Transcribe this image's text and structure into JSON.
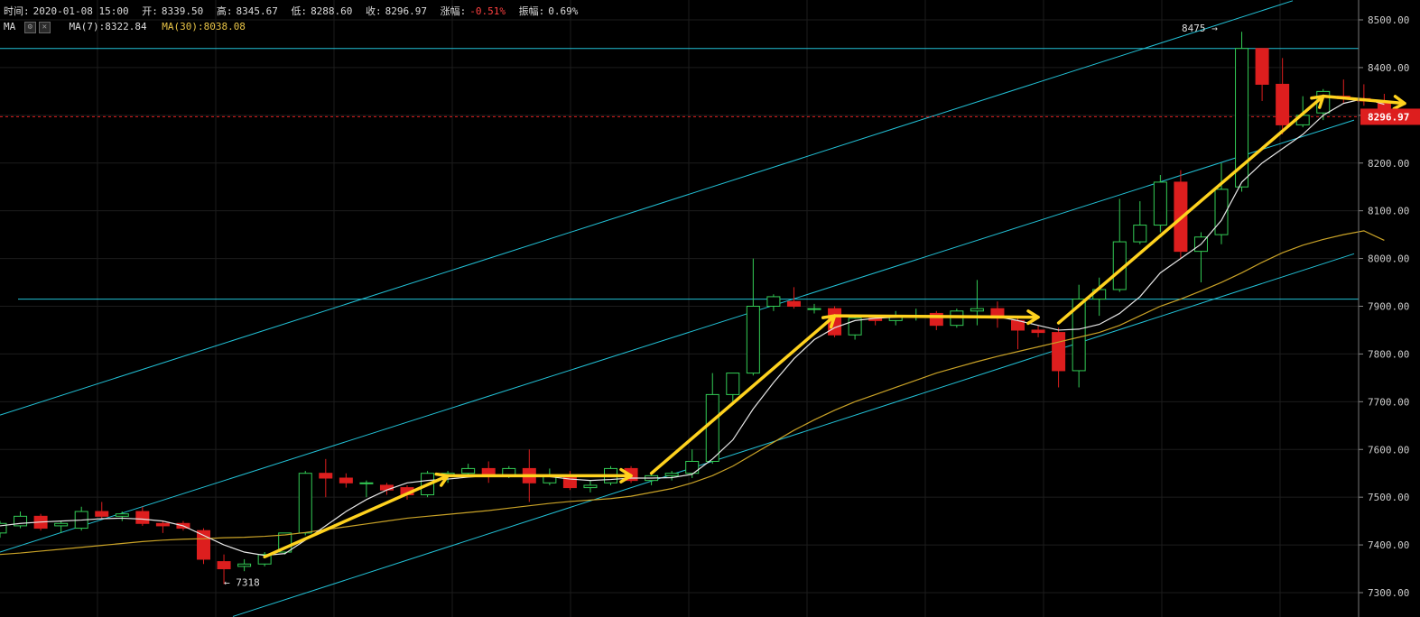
{
  "header": {
    "time_label": "时间:",
    "time_value": "2020-01-08 15:00",
    "open_label": "开:",
    "open_value": "8339.50",
    "high_label": "高:",
    "high_value": "8345.67",
    "low_label": "低:",
    "low_value": "8288.60",
    "close_label": "收:",
    "close_value": "8296.97",
    "change_label": "涨幅:",
    "change_value": "-0.51%",
    "amplitude_label": "振幅:",
    "amplitude_value": "0.69%"
  },
  "indicators": {
    "ma_label": "MA",
    "ma7_text": "MA(7):8322.84",
    "ma30_text": "MA(30):8038.08"
  },
  "colors": {
    "up": "#33cc55",
    "down": "#dd1e1e",
    "ma7": "#e6e6e6",
    "ma30": "#c9a227",
    "trendline": "#22c1d6",
    "arrow": "#ffd21e",
    "current_price": "#dd1e1e",
    "grid": "#1c1c1c"
  },
  "chart_data": {
    "type": "candlestick",
    "yticks": [
      7300,
      7400,
      7500,
      7600,
      7700,
      7800,
      7900,
      8000,
      8100,
      8200,
      8300,
      8400,
      8500
    ],
    "ytick_labels": [
      "7300.00",
      "7400.00",
      "7500.00",
      "7600.00",
      "7700.00",
      "7800.00",
      "7900.00",
      "8000.00",
      "8100.00",
      "8200.00",
      "8300.00",
      "8400.00",
      "8500.00"
    ],
    "ylim": [
      7250,
      8540
    ],
    "current_price": 8296.97,
    "current_price_label": "8296.97",
    "annotations": [
      {
        "text": "← 7318",
        "x": 11,
        "y": 7318
      },
      {
        "text": "8475 →",
        "x": 60,
        "y": 8475
      }
    ],
    "candles": [
      [
        7425,
        7450,
        7415,
        7445
      ],
      [
        7440,
        7470,
        7435,
        7460
      ],
      [
        7460,
        7465,
        7430,
        7435
      ],
      [
        7440,
        7450,
        7425,
        7445
      ],
      [
        7435,
        7480,
        7430,
        7470
      ],
      [
        7470,
        7490,
        7455,
        7460
      ],
      [
        7460,
        7470,
        7450,
        7465
      ],
      [
        7470,
        7480,
        7440,
        7445
      ],
      [
        7445,
        7450,
        7425,
        7440
      ],
      [
        7445,
        7450,
        7430,
        7435
      ],
      [
        7430,
        7435,
        7360,
        7370
      ],
      [
        7365,
        7380,
        7318,
        7350
      ],
      [
        7355,
        7370,
        7345,
        7360
      ],
      [
        7360,
        7385,
        7355,
        7380
      ],
      [
        7385,
        7425,
        7380,
        7425
      ],
      [
        7425,
        7555,
        7420,
        7550
      ],
      [
        7550,
        7580,
        7500,
        7540
      ],
      [
        7540,
        7550,
        7520,
        7530
      ],
      [
        7530,
        7535,
        7500,
        7530
      ],
      [
        7525,
        7530,
        7505,
        7515
      ],
      [
        7520,
        7525,
        7495,
        7505
      ],
      [
        7505,
        7555,
        7500,
        7550
      ],
      [
        7545,
        7555,
        7530,
        7550
      ],
      [
        7550,
        7570,
        7545,
        7560
      ],
      [
        7560,
        7575,
        7530,
        7545
      ],
      [
        7545,
        7565,
        7540,
        7560
      ],
      [
        7560,
        7600,
        7490,
        7530
      ],
      [
        7530,
        7560,
        7525,
        7545
      ],
      [
        7545,
        7555,
        7515,
        7520
      ],
      [
        7520,
        7535,
        7510,
        7525
      ],
      [
        7530,
        7565,
        7525,
        7560
      ],
      [
        7560,
        7565,
        7530,
        7535
      ],
      [
        7535,
        7550,
        7525,
        7545
      ],
      [
        7545,
        7555,
        7535,
        7550
      ],
      [
        7550,
        7600,
        7540,
        7575
      ],
      [
        7575,
        7760,
        7570,
        7715
      ],
      [
        7715,
        7760,
        7700,
        7760
      ],
      [
        7760,
        8000,
        7755,
        7900
      ],
      [
        7900,
        7925,
        7890,
        7920
      ],
      [
        7910,
        7940,
        7895,
        7900
      ],
      [
        7895,
        7905,
        7885,
        7895
      ],
      [
        7895,
        7900,
        7835,
        7840
      ],
      [
        7840,
        7880,
        7830,
        7875
      ],
      [
        7875,
        7880,
        7860,
        7870
      ],
      [
        7870,
        7890,
        7860,
        7880
      ],
      [
        7880,
        7895,
        7870,
        7880
      ],
      [
        7885,
        7890,
        7850,
        7860
      ],
      [
        7860,
        7895,
        7855,
        7890
      ],
      [
        7890,
        7955,
        7860,
        7895
      ],
      [
        7895,
        7910,
        7855,
        7875
      ],
      [
        7870,
        7880,
        7810,
        7850
      ],
      [
        7850,
        7860,
        7835,
        7845
      ],
      [
        7845,
        7855,
        7730,
        7765
      ],
      [
        7765,
        7945,
        7730,
        7915
      ],
      [
        7915,
        7960,
        7880,
        7935
      ],
      [
        7935,
        8125,
        7930,
        8035
      ],
      [
        8035,
        8120,
        8030,
        8070
      ],
      [
        8070,
        8175,
        8055,
        8160
      ],
      [
        8160,
        8185,
        8000,
        8015
      ],
      [
        8015,
        8055,
        7950,
        8045
      ],
      [
        8050,
        8200,
        8030,
        8145
      ],
      [
        8150,
        8475,
        8140,
        8440
      ],
      [
        8440,
        8440,
        8330,
        8365
      ],
      [
        8365,
        8420,
        8260,
        8280
      ],
      [
        8280,
        8340,
        8275,
        8300
      ],
      [
        8305,
        8355,
        8290,
        8350
      ],
      [
        8340,
        8375,
        8325,
        8335
      ],
      [
        8335,
        8365,
        8320,
        8330
      ],
      [
        8330,
        8345,
        8288,
        8297
      ]
    ],
    "ma7": [
      7440,
      7445,
      7448,
      7450,
      7452,
      7455,
      7456,
      7454,
      7450,
      7440,
      7420,
      7400,
      7385,
      7378,
      7382,
      7410,
      7440,
      7470,
      7495,
      7515,
      7530,
      7535,
      7538,
      7542,
      7545,
      7546,
      7545,
      7543,
      7538,
      7535,
      7537,
      7540,
      7540,
      7541,
      7548,
      7580,
      7620,
      7685,
      7740,
      7790,
      7830,
      7855,
      7870,
      7875,
      7877,
      7880,
      7880,
      7878,
      7880,
      7878,
      7870,
      7860,
      7850,
      7852,
      7862,
      7885,
      7920,
      7970,
      8000,
      8030,
      8080,
      8160,
      8200,
      8230,
      8260,
      8300,
      8325,
      8335,
      8323
    ],
    "ma30": [
      7380,
      7383,
      7387,
      7391,
      7395,
      7399,
      7403,
      7407,
      7410,
      7412,
      7413,
      7415,
      7416,
      7418,
      7421,
      7426,
      7432,
      7438,
      7444,
      7450,
      7456,
      7460,
      7464,
      7468,
      7472,
      7477,
      7482,
      7487,
      7491,
      7494,
      7497,
      7502,
      7510,
      7518,
      7530,
      7545,
      7565,
      7590,
      7615,
      7640,
      7662,
      7682,
      7700,
      7715,
      7730,
      7745,
      7760,
      7772,
      7784,
      7795,
      7805,
      7815,
      7825,
      7835,
      7845,
      7860,
      7880,
      7900,
      7915,
      7932,
      7950,
      7970,
      7992,
      8012,
      8028,
      8040,
      8050,
      8058,
      8038
    ],
    "trendlines": [
      {
        "p1": [
          0,
          7672
        ],
        "p2": [
          1432,
          8540
        ]
      },
      {
        "p1": [
          0,
          7385
        ],
        "p2": [
          1500,
          8290
        ]
      },
      {
        "p1": [
          258,
          7250
        ],
        "p2": [
          1500,
          8010
        ]
      },
      {
        "p1": [
          0,
          8440
        ],
        "p2": [
          1505,
          8440
        ]
      },
      {
        "p1": [
          20,
          7915
        ],
        "p2": [
          1505,
          7915
        ]
      }
    ],
    "arrows": [
      {
        "from": [
          13,
          7375
        ],
        "to": [
          22,
          7545
        ]
      },
      {
        "from": [
          22,
          7545
        ],
        "to": [
          31,
          7545
        ]
      },
      {
        "from": [
          32,
          7550
        ],
        "to": [
          41,
          7880
        ]
      },
      {
        "from": [
          41,
          7880
        ],
        "to": [
          51,
          7877
        ]
      },
      {
        "from": [
          52,
          7865
        ],
        "to": [
          65,
          8340
        ]
      },
      {
        "from": [
          65,
          8340
        ],
        "to": [
          69,
          8325
        ]
      }
    ]
  }
}
